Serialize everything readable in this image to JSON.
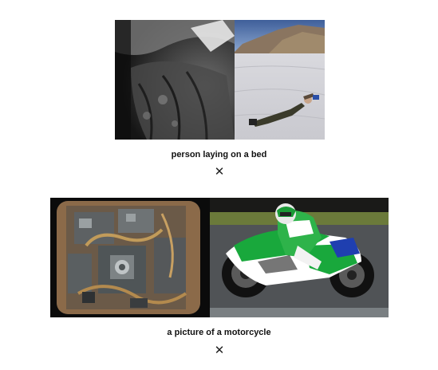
{
  "pairs": [
    {
      "caption": "person laying on a bed",
      "close_glyph": "✕",
      "images": [
        {
          "subject": "grayscale-fabric-photo"
        },
        {
          "subject": "person-lying-on-salt-flat-photo"
        }
      ]
    },
    {
      "caption": "a picture of a motorcycle",
      "close_glyph": "✕",
      "images": [
        {
          "subject": "rover-machinery-photo"
        },
        {
          "subject": "motorcycle-racer-photo"
        }
      ]
    }
  ],
  "colors": {
    "background": "#ffffff",
    "caption_text": "#111111",
    "close_icon": "#222222"
  }
}
